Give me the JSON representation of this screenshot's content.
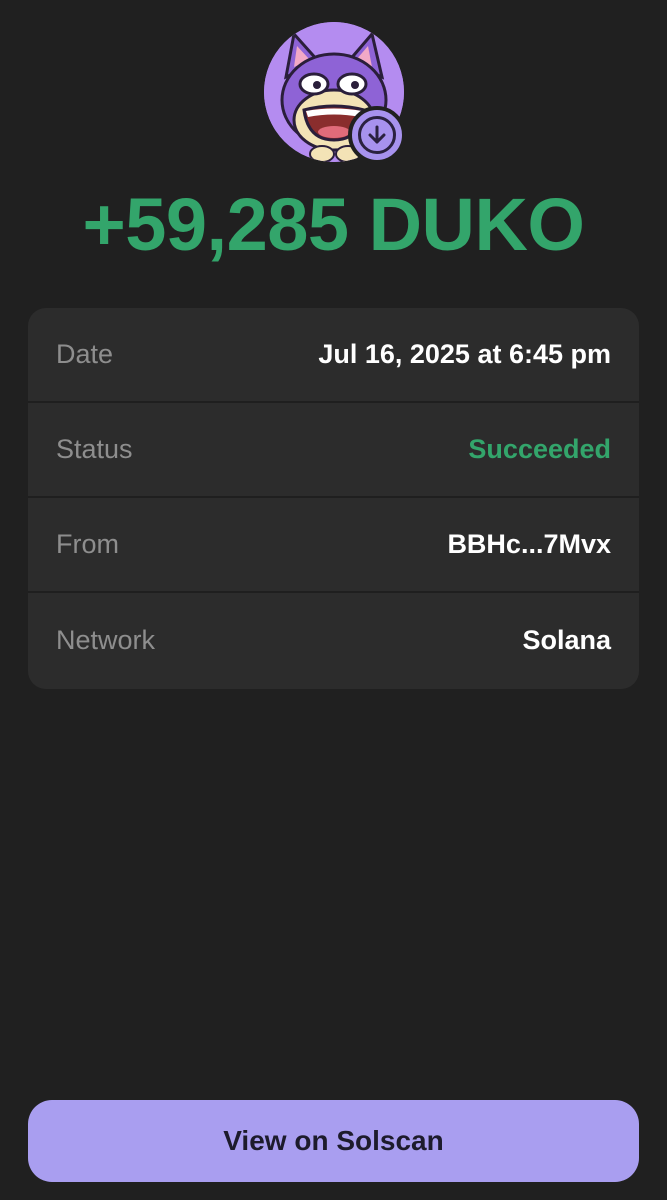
{
  "token": {
    "avatar_icon": "duko-cat-avatar-icon",
    "badge_icon": "arrow-down-icon",
    "amount": "+59,285 DUKO"
  },
  "details": [
    {
      "label": "Date",
      "value": "Jul 16, 2025 at 6:45 pm",
      "status": "normal"
    },
    {
      "label": "Status",
      "value": "Succeeded",
      "status": "success"
    },
    {
      "label": "From",
      "value": "BBHc...7Mvx",
      "status": "normal"
    },
    {
      "label": "Network",
      "value": "Solana",
      "status": "normal"
    }
  ],
  "actions": {
    "view_button_label": "View on Solscan"
  },
  "colors": {
    "background": "#202020",
    "card": "#2c2c2c",
    "success": "#33a56b",
    "accent": "#a99ef0"
  }
}
